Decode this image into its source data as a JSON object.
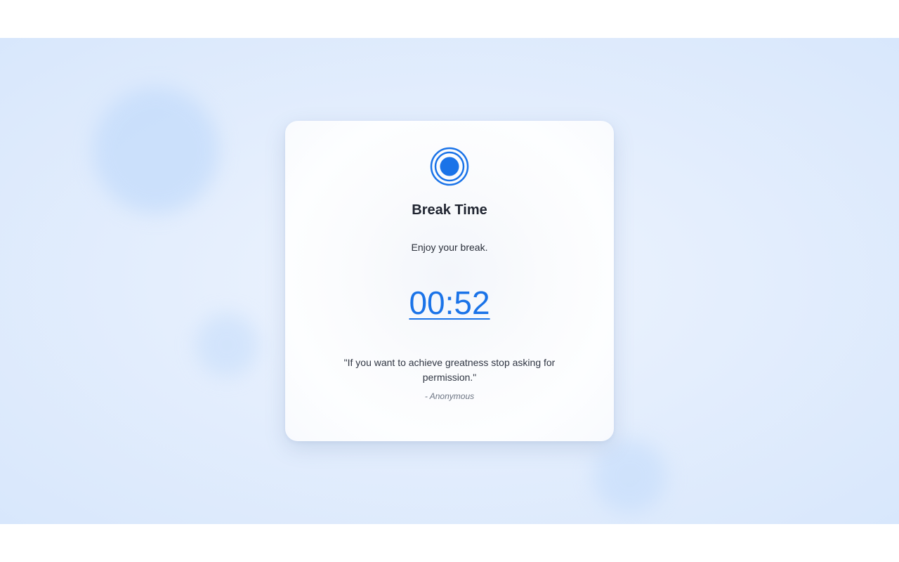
{
  "break_card": {
    "icon": "target-icon",
    "title": "Break Time",
    "message": "Enjoy your break.",
    "timer": "00:52",
    "quote": "\"If you want to achieve greatness stop asking for permission.\"",
    "author": "- Anonymous"
  },
  "colors": {
    "accent": "#1a73e8",
    "background": "#e4eefd",
    "card": "#fdfeff",
    "title_text": "#1f2430",
    "muted_text": "#6b7382"
  }
}
